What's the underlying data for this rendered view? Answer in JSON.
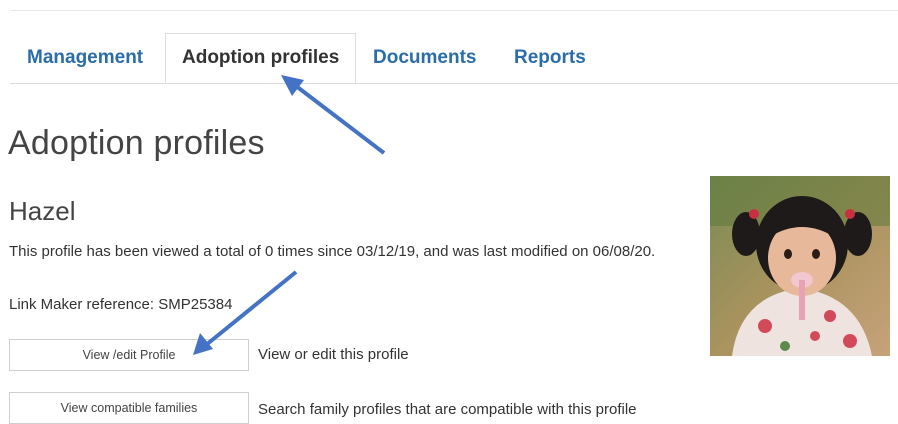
{
  "tabs": [
    {
      "label": "Management",
      "active": false
    },
    {
      "label": "Adoption profiles",
      "active": true
    },
    {
      "label": "Documents",
      "active": false
    },
    {
      "label": "Reports",
      "active": false
    }
  ],
  "page": {
    "title": "Adoption profiles",
    "child_name": "Hazel",
    "view_info": "This profile has been viewed a total of 0 times since 03/12/19, and was last modified on 06/08/20.",
    "reference": "Link Maker reference: SMP25384"
  },
  "actions": [
    {
      "button_label": "View /edit Profile",
      "description": "View or edit this profile"
    },
    {
      "button_label": "View compatible families",
      "description": "Search family profiles that are compatible with this profile"
    }
  ],
  "colors": {
    "tab_link": "#2a6da8",
    "annotation_arrow": "#4472c4"
  },
  "annotations": {
    "arrow_icon": "arrow-icon"
  }
}
